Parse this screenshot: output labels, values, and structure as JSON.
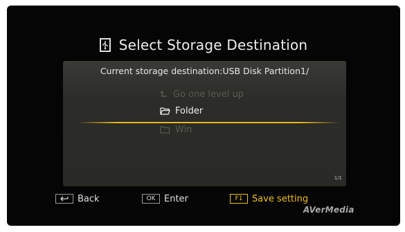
{
  "dialog": {
    "title": "Select Storage Destination",
    "title_icon": "usb-storage-icon",
    "current_destination": "Current storage destination:USB Disk Partition1/"
  },
  "list": {
    "items": [
      {
        "label": "Go one level up",
        "icon": "level-up-icon",
        "state": "dimmed"
      },
      {
        "label": "Folder",
        "icon": "folder-icon",
        "state": "selected"
      },
      {
        "label": "Win",
        "icon": "folder-icon",
        "state": "dimmed"
      }
    ],
    "page_indicator": "1/1"
  },
  "hints": {
    "back": {
      "key": "⮌",
      "label": "Back"
    },
    "enter": {
      "key": "OK",
      "label": "Enter"
    },
    "save": {
      "key": "F1",
      "label": "Save setting"
    }
  },
  "brand": {
    "logo_text": "AVerMedia"
  },
  "colors": {
    "accent": "#e8b820",
    "background": "#050505",
    "panel": "#2e2e2a",
    "dimmed_text": "#5a5a52"
  }
}
